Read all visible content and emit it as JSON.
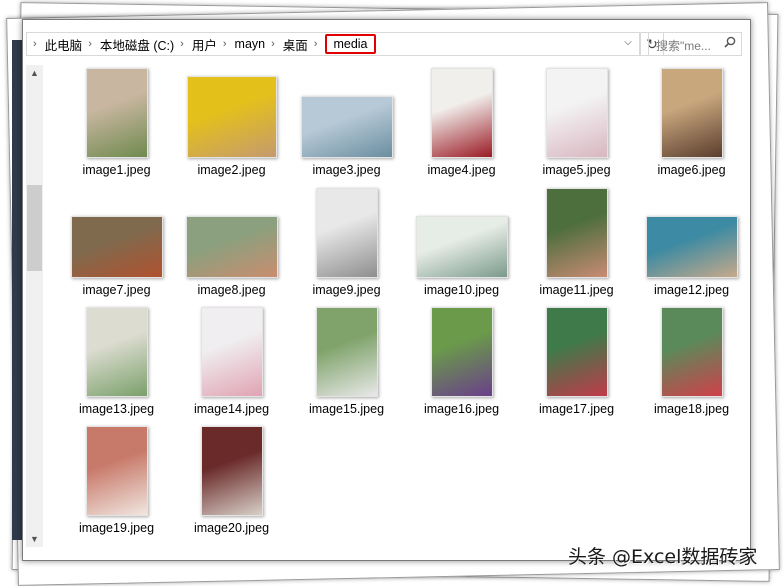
{
  "breadcrumb": {
    "items": [
      "此电脑",
      "本地磁盘 (C:)",
      "用户",
      "mayn",
      "桌面",
      "media"
    ],
    "separator": "›"
  },
  "search": {
    "placeholder": "搜索\"me..."
  },
  "icons": {
    "dropdown": "chevron-down-icon",
    "refresh": "refresh-icon",
    "search": "search-icon",
    "scroll_up": "scroll-up-icon",
    "scroll_down": "scroll-down-icon"
  },
  "colors": {
    "highlight_border": "#e00000",
    "window_border": "#7a7a7a"
  },
  "files": [
    {
      "name": "image1.jpeg",
      "orientation": "portrait",
      "colors": [
        "#c8b6a0",
        "#6f8a4e"
      ]
    },
    {
      "name": "image2.jpeg",
      "orientation": "portrait-square",
      "colors": [
        "#e4c11a",
        "#c59a6e"
      ]
    },
    {
      "name": "image3.jpeg",
      "orientation": "landscape",
      "colors": [
        "#b7c9d6",
        "#6a8ea0"
      ]
    },
    {
      "name": "image4.jpeg",
      "orientation": "portrait",
      "colors": [
        "#f1efec",
        "#9a1a24"
      ]
    },
    {
      "name": "image5.jpeg",
      "orientation": "portrait",
      "colors": [
        "#f3f3f3",
        "#d8b6c0"
      ]
    },
    {
      "name": "image6.jpeg",
      "orientation": "portrait",
      "colors": [
        "#c9a77d",
        "#5a3d2e"
      ]
    },
    {
      "name": "image7.jpeg",
      "orientation": "landscape",
      "colors": [
        "#7f6a4e",
        "#b0522f"
      ]
    },
    {
      "name": "image8.jpeg",
      "orientation": "landscape",
      "colors": [
        "#8aa07e",
        "#c98d6f"
      ]
    },
    {
      "name": "image9.jpeg",
      "orientation": "portrait",
      "colors": [
        "#e8e8e8",
        "#8e8e8e"
      ]
    },
    {
      "name": "image10.jpeg",
      "orientation": "landscape",
      "colors": [
        "#e6ece6",
        "#7b9a8b"
      ]
    },
    {
      "name": "image11.jpeg",
      "orientation": "portrait",
      "colors": [
        "#4d6e3d",
        "#c98b74"
      ]
    },
    {
      "name": "image12.jpeg",
      "orientation": "landscape",
      "colors": [
        "#3c8aa3",
        "#c7a98a"
      ]
    },
    {
      "name": "image13.jpeg",
      "orientation": "portrait",
      "colors": [
        "#dcdcd0",
        "#7aa06a"
      ]
    },
    {
      "name": "image14.jpeg",
      "orientation": "portrait",
      "colors": [
        "#f0eef0",
        "#e0a3b3"
      ]
    },
    {
      "name": "image15.jpeg",
      "orientation": "portrait",
      "colors": [
        "#7fa36a",
        "#e8e8e8"
      ]
    },
    {
      "name": "image16.jpeg",
      "orientation": "portrait",
      "colors": [
        "#6a9a4a",
        "#6a3f8a"
      ]
    },
    {
      "name": "image17.jpeg",
      "orientation": "portrait",
      "colors": [
        "#3f7a4a",
        "#c03a4a"
      ]
    },
    {
      "name": "image18.jpeg",
      "orientation": "portrait",
      "colors": [
        "#5a8a5a",
        "#d0404a"
      ]
    },
    {
      "name": "image19.jpeg",
      "orientation": "portrait",
      "colors": [
        "#c87a6a",
        "#f0e6e0"
      ]
    },
    {
      "name": "image20.jpeg",
      "orientation": "portrait",
      "colors": [
        "#6a2a2a",
        "#d8d0c8"
      ]
    }
  ],
  "watermark": "头条 @Excel数据砖家"
}
